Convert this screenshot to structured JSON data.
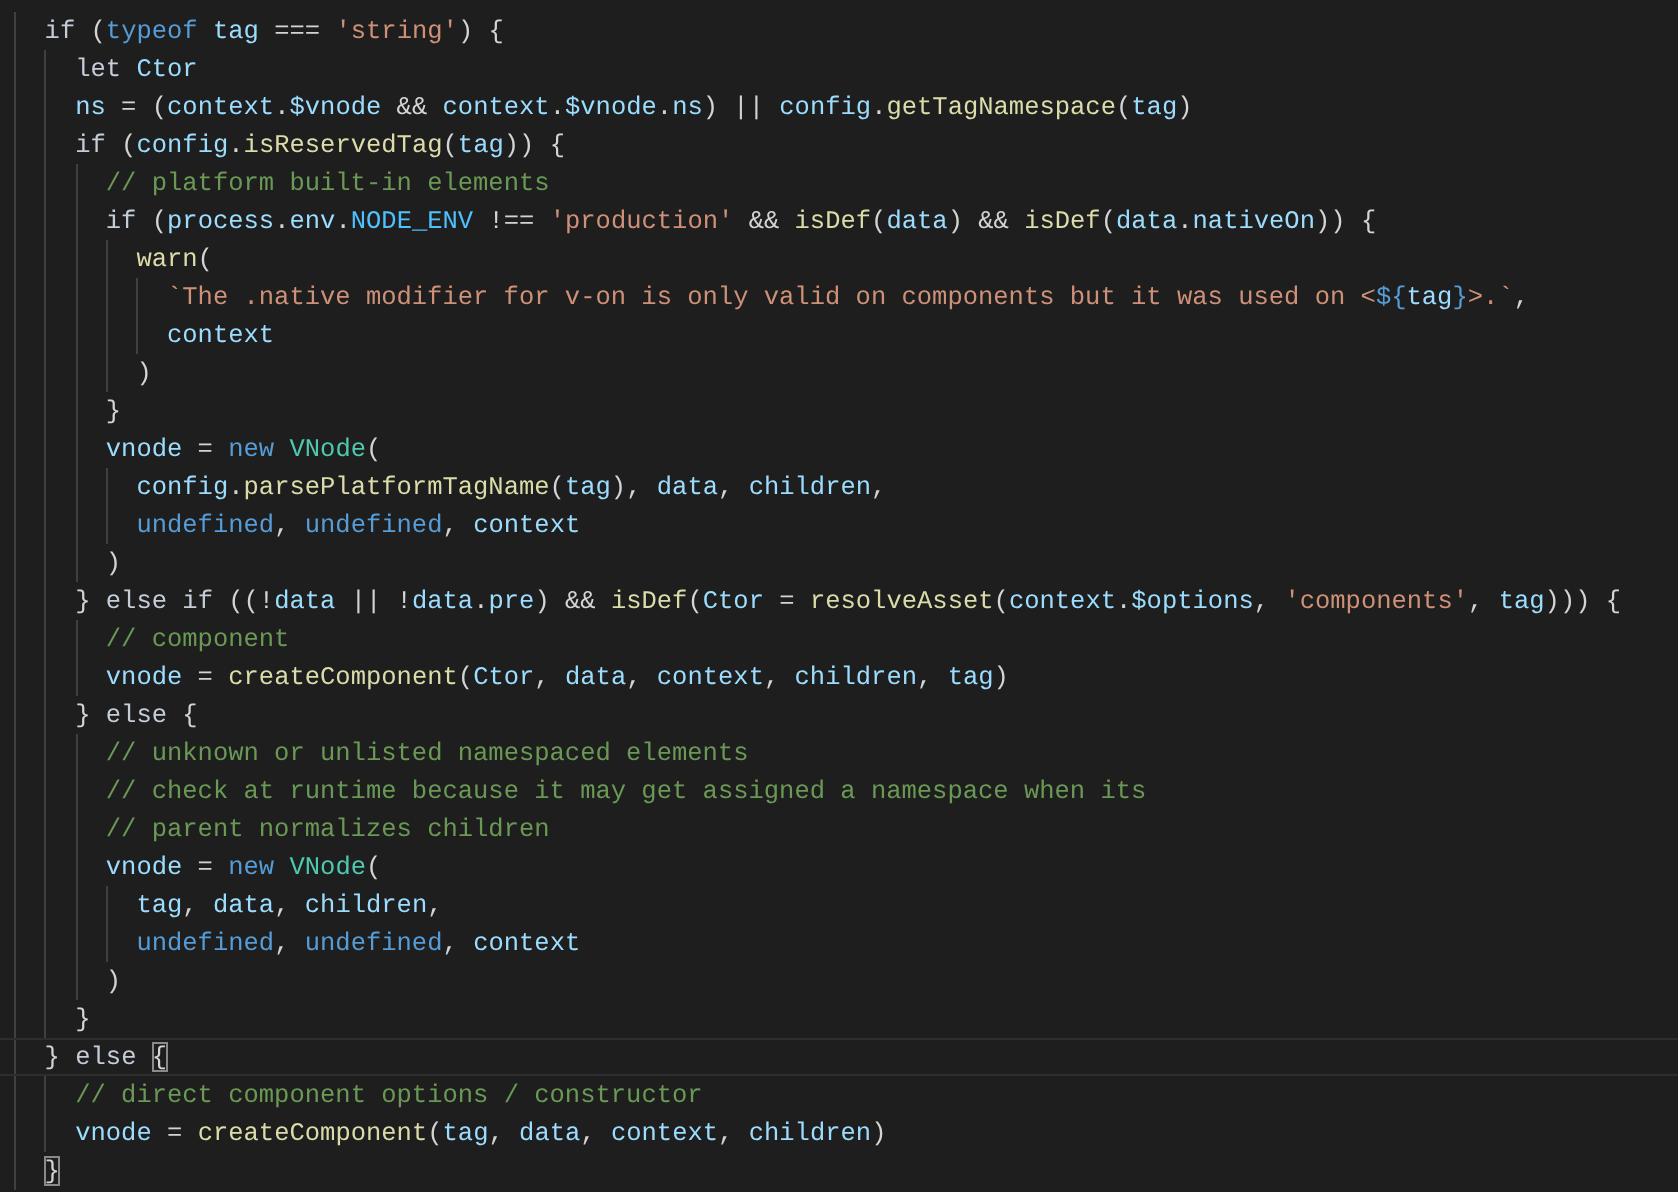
{
  "editor": {
    "lines": [
      {
        "current": false,
        "tokens": [
          {
            "text": "  if",
            "kind": "kw"
          },
          {
            "text": " (",
            "kind": "p"
          },
          {
            "text": "typeof",
            "kind": "sk"
          },
          {
            "text": " tag ",
            "kind": "v"
          },
          {
            "text": "=== ",
            "kind": "p"
          },
          {
            "text": "'string'",
            "kind": "s"
          },
          {
            "text": ") {",
            "kind": "p"
          }
        ]
      },
      {
        "current": false,
        "tokens": [
          {
            "text": "    let ",
            "kind": "kw"
          },
          {
            "text": "Ctor",
            "kind": "v"
          }
        ]
      },
      {
        "current": false,
        "tokens": [
          {
            "text": "    ns",
            "kind": "v"
          },
          {
            "text": " = (",
            "kind": "p"
          },
          {
            "text": "context",
            "kind": "v"
          },
          {
            "text": ".",
            "kind": "p"
          },
          {
            "text": "$vnode",
            "kind": "v"
          },
          {
            "text": " && ",
            "kind": "p"
          },
          {
            "text": "context",
            "kind": "v"
          },
          {
            "text": ".",
            "kind": "p"
          },
          {
            "text": "$vnode",
            "kind": "v"
          },
          {
            "text": ".",
            "kind": "p"
          },
          {
            "text": "ns",
            "kind": "v"
          },
          {
            "text": ") || ",
            "kind": "p"
          },
          {
            "text": "config",
            "kind": "v"
          },
          {
            "text": ".",
            "kind": "p"
          },
          {
            "text": "getTagNamespace",
            "kind": "f"
          },
          {
            "text": "(",
            "kind": "p"
          },
          {
            "text": "tag",
            "kind": "v"
          },
          {
            "text": ")",
            "kind": "p"
          }
        ]
      },
      {
        "current": false,
        "tokens": [
          {
            "text": "    if",
            "kind": "kw"
          },
          {
            "text": " (",
            "kind": "p"
          },
          {
            "text": "config",
            "kind": "v"
          },
          {
            "text": ".",
            "kind": "p"
          },
          {
            "text": "isReservedTag",
            "kind": "f"
          },
          {
            "text": "(",
            "kind": "p"
          },
          {
            "text": "tag",
            "kind": "v"
          },
          {
            "text": ")) {",
            "kind": "p"
          }
        ]
      },
      {
        "current": false,
        "tokens": [
          {
            "text": "      // platform built-in elements",
            "kind": "c"
          }
        ]
      },
      {
        "current": false,
        "tokens": [
          {
            "text": "      if",
            "kind": "kw"
          },
          {
            "text": " (",
            "kind": "p"
          },
          {
            "text": "process",
            "kind": "v"
          },
          {
            "text": ".",
            "kind": "p"
          },
          {
            "text": "env",
            "kind": "v"
          },
          {
            "text": ".",
            "kind": "p"
          },
          {
            "text": "NODE_ENV",
            "kind": "k"
          },
          {
            "text": " !== ",
            "kind": "p"
          },
          {
            "text": "'production'",
            "kind": "s"
          },
          {
            "text": " && ",
            "kind": "p"
          },
          {
            "text": "isDef",
            "kind": "f"
          },
          {
            "text": "(",
            "kind": "p"
          },
          {
            "text": "data",
            "kind": "v"
          },
          {
            "text": ") && ",
            "kind": "p"
          },
          {
            "text": "isDef",
            "kind": "f"
          },
          {
            "text": "(",
            "kind": "p"
          },
          {
            "text": "data",
            "kind": "v"
          },
          {
            "text": ".",
            "kind": "p"
          },
          {
            "text": "nativeOn",
            "kind": "v"
          },
          {
            "text": ")) {",
            "kind": "p"
          }
        ]
      },
      {
        "current": false,
        "tokens": [
          {
            "text": "        warn",
            "kind": "f"
          },
          {
            "text": "(",
            "kind": "p"
          }
        ]
      },
      {
        "current": false,
        "tokens": [
          {
            "text": "          `The .native modifier for v-on is only valid on components but it was used on <",
            "kind": "s"
          },
          {
            "text": "${",
            "kind": "sk"
          },
          {
            "text": "tag",
            "kind": "v"
          },
          {
            "text": "}",
            "kind": "sk"
          },
          {
            "text": ">.`",
            "kind": "s"
          },
          {
            "text": ",",
            "kind": "p"
          }
        ]
      },
      {
        "current": false,
        "tokens": [
          {
            "text": "          context",
            "kind": "v"
          }
        ]
      },
      {
        "current": false,
        "tokens": [
          {
            "text": "        )",
            "kind": "p"
          }
        ]
      },
      {
        "current": false,
        "tokens": [
          {
            "text": "      }",
            "kind": "p"
          }
        ]
      },
      {
        "current": false,
        "tokens": [
          {
            "text": "      vnode",
            "kind": "v"
          },
          {
            "text": " = ",
            "kind": "p"
          },
          {
            "text": "new ",
            "kind": "sk"
          },
          {
            "text": "VNode",
            "kind": "cl"
          },
          {
            "text": "(",
            "kind": "p"
          }
        ]
      },
      {
        "current": false,
        "tokens": [
          {
            "text": "        config",
            "kind": "v"
          },
          {
            "text": ".",
            "kind": "p"
          },
          {
            "text": "parsePlatformTagName",
            "kind": "f"
          },
          {
            "text": "(",
            "kind": "p"
          },
          {
            "text": "tag",
            "kind": "v"
          },
          {
            "text": "), ",
            "kind": "p"
          },
          {
            "text": "data",
            "kind": "v"
          },
          {
            "text": ", ",
            "kind": "p"
          },
          {
            "text": "children",
            "kind": "v"
          },
          {
            "text": ",",
            "kind": "p"
          }
        ]
      },
      {
        "current": false,
        "tokens": [
          {
            "text": "        undefined",
            "kind": "sk"
          },
          {
            "text": ", ",
            "kind": "p"
          },
          {
            "text": "undefined",
            "kind": "sk"
          },
          {
            "text": ", ",
            "kind": "p"
          },
          {
            "text": "context",
            "kind": "v"
          }
        ]
      },
      {
        "current": false,
        "tokens": [
          {
            "text": "      )",
            "kind": "p"
          }
        ]
      },
      {
        "current": false,
        "tokens": [
          {
            "text": "    } ",
            "kind": "p"
          },
          {
            "text": "else if",
            "kind": "kw"
          },
          {
            "text": " ((!",
            "kind": "p"
          },
          {
            "text": "data",
            "kind": "v"
          },
          {
            "text": " || !",
            "kind": "p"
          },
          {
            "text": "data",
            "kind": "v"
          },
          {
            "text": ".",
            "kind": "p"
          },
          {
            "text": "pre",
            "kind": "v"
          },
          {
            "text": ") && ",
            "kind": "p"
          },
          {
            "text": "isDef",
            "kind": "f"
          },
          {
            "text": "(",
            "kind": "p"
          },
          {
            "text": "Ctor",
            "kind": "v"
          },
          {
            "text": " = ",
            "kind": "p"
          },
          {
            "text": "resolveAsset",
            "kind": "f"
          },
          {
            "text": "(",
            "kind": "p"
          },
          {
            "text": "context",
            "kind": "v"
          },
          {
            "text": ".",
            "kind": "p"
          },
          {
            "text": "$options",
            "kind": "v"
          },
          {
            "text": ", ",
            "kind": "p"
          },
          {
            "text": "'components'",
            "kind": "s"
          },
          {
            "text": ", ",
            "kind": "p"
          },
          {
            "text": "tag",
            "kind": "v"
          },
          {
            "text": "))) {",
            "kind": "p"
          }
        ]
      },
      {
        "current": false,
        "tokens": [
          {
            "text": "      // component",
            "kind": "c"
          }
        ]
      },
      {
        "current": false,
        "tokens": [
          {
            "text": "      vnode",
            "kind": "v"
          },
          {
            "text": " = ",
            "kind": "p"
          },
          {
            "text": "createComponent",
            "kind": "f"
          },
          {
            "text": "(",
            "kind": "p"
          },
          {
            "text": "Ctor",
            "kind": "v"
          },
          {
            "text": ", ",
            "kind": "p"
          },
          {
            "text": "data",
            "kind": "v"
          },
          {
            "text": ", ",
            "kind": "p"
          },
          {
            "text": "context",
            "kind": "v"
          },
          {
            "text": ", ",
            "kind": "p"
          },
          {
            "text": "children",
            "kind": "v"
          },
          {
            "text": ", ",
            "kind": "p"
          },
          {
            "text": "tag",
            "kind": "v"
          },
          {
            "text": ")",
            "kind": "p"
          }
        ]
      },
      {
        "current": false,
        "tokens": [
          {
            "text": "    } ",
            "kind": "p"
          },
          {
            "text": "else",
            "kind": "kw"
          },
          {
            "text": " {",
            "kind": "p"
          }
        ]
      },
      {
        "current": false,
        "tokens": [
          {
            "text": "      // unknown or unlisted namespaced elements",
            "kind": "c"
          }
        ]
      },
      {
        "current": false,
        "tokens": [
          {
            "text": "      // check at runtime because it may get assigned a namespace when its",
            "kind": "c"
          }
        ]
      },
      {
        "current": false,
        "tokens": [
          {
            "text": "      // parent normalizes children",
            "kind": "c"
          }
        ]
      },
      {
        "current": false,
        "tokens": [
          {
            "text": "      vnode",
            "kind": "v"
          },
          {
            "text": " = ",
            "kind": "p"
          },
          {
            "text": "new ",
            "kind": "sk"
          },
          {
            "text": "VNode",
            "kind": "cl"
          },
          {
            "text": "(",
            "kind": "p"
          }
        ]
      },
      {
        "current": false,
        "tokens": [
          {
            "text": "        tag",
            "kind": "v"
          },
          {
            "text": ", ",
            "kind": "p"
          },
          {
            "text": "data",
            "kind": "v"
          },
          {
            "text": ", ",
            "kind": "p"
          },
          {
            "text": "children",
            "kind": "v"
          },
          {
            "text": ",",
            "kind": "p"
          }
        ]
      },
      {
        "current": false,
        "tokens": [
          {
            "text": "        undefined",
            "kind": "sk"
          },
          {
            "text": ", ",
            "kind": "p"
          },
          {
            "text": "undefined",
            "kind": "sk"
          },
          {
            "text": ", ",
            "kind": "p"
          },
          {
            "text": "context",
            "kind": "v"
          }
        ]
      },
      {
        "current": false,
        "tokens": [
          {
            "text": "      )",
            "kind": "p"
          }
        ]
      },
      {
        "current": false,
        "tokens": [
          {
            "text": "    }",
            "kind": "p"
          }
        ]
      },
      {
        "current": true,
        "tokens": [
          {
            "text": "  } ",
            "kind": "p"
          },
          {
            "text": "else ",
            "kind": "kw"
          },
          {
            "text": "{",
            "kind": "bm"
          }
        ]
      },
      {
        "current": false,
        "tokens": [
          {
            "text": "    // direct component options / constructor",
            "kind": "c"
          }
        ]
      },
      {
        "current": false,
        "tokens": [
          {
            "text": "    vnode",
            "kind": "v"
          },
          {
            "text": " = ",
            "kind": "p"
          },
          {
            "text": "createComponent",
            "kind": "f"
          },
          {
            "text": "(",
            "kind": "p"
          },
          {
            "text": "tag",
            "kind": "v"
          },
          {
            "text": ", ",
            "kind": "p"
          },
          {
            "text": "data",
            "kind": "v"
          },
          {
            "text": ", ",
            "kind": "p"
          },
          {
            "text": "context",
            "kind": "v"
          },
          {
            "text": ", ",
            "kind": "p"
          },
          {
            "text": "children",
            "kind": "v"
          },
          {
            "text": ")",
            "kind": "p"
          }
        ]
      },
      {
        "current": false,
        "tokens": [
          {
            "text": "  }",
            "kind": "bm"
          }
        ]
      }
    ]
  }
}
